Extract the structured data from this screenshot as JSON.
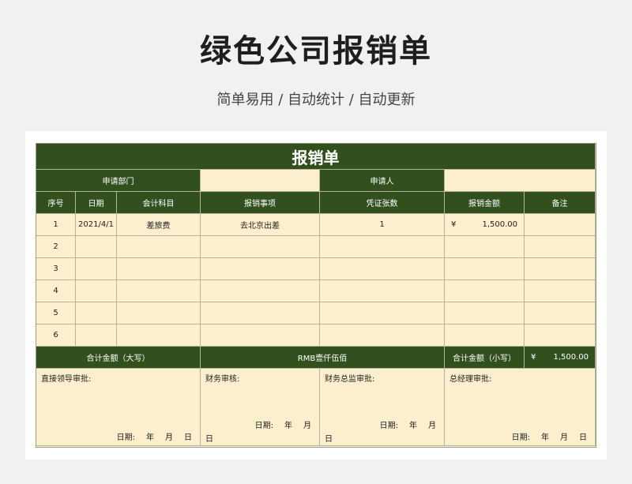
{
  "page": {
    "title": "绿色公司报销单",
    "subtitle": "简单易用  /  自动统计  /  自动更新"
  },
  "form": {
    "banner": "报销单",
    "dept_label": "申请部门",
    "dept_value": "",
    "applicant_label": "申请人",
    "applicant_value": "",
    "headers": [
      "序号",
      "日期",
      "会计科目",
      "报销事项",
      "凭证张数",
      "报销金额",
      "备注"
    ],
    "rows": [
      {
        "no": "1",
        "date": "2021/4/1",
        "subject": "差旅费",
        "item": "去北京出差",
        "vouchers": "1",
        "currency": "¥",
        "amount": "1,500.00",
        "note": ""
      },
      {
        "no": "2",
        "date": "",
        "subject": "",
        "item": "",
        "vouchers": "",
        "currency": "",
        "amount": "",
        "note": ""
      },
      {
        "no": "3",
        "date": "",
        "subject": "",
        "item": "",
        "vouchers": "",
        "currency": "",
        "amount": "",
        "note": ""
      },
      {
        "no": "4",
        "date": "",
        "subject": "",
        "item": "",
        "vouchers": "",
        "currency": "",
        "amount": "",
        "note": ""
      },
      {
        "no": "5",
        "date": "",
        "subject": "",
        "item": "",
        "vouchers": "",
        "currency": "",
        "amount": "",
        "note": ""
      },
      {
        "no": "6",
        "date": "",
        "subject": "",
        "item": "",
        "vouchers": "",
        "currency": "",
        "amount": "",
        "note": ""
      }
    ],
    "total": {
      "upper_label": "合计金额（大写）",
      "upper_value": "RMB壹仟伍佰",
      "lower_label": "合计金额（小写）",
      "currency": "¥",
      "lower_value": "1,500.00"
    },
    "signatures": [
      {
        "label": "直接领导审批:",
        "date": [
          "日期:",
          "年",
          "月",
          "日"
        ],
        "tail": ""
      },
      {
        "label": "财务审核:",
        "date": [
          "日期:",
          "年",
          "月"
        ],
        "tail": "日"
      },
      {
        "label": "财务总监审批:",
        "date": [
          "日期:",
          "年",
          "月"
        ],
        "tail": "日"
      },
      {
        "label": "总经理审批:",
        "date": [
          "日期:",
          "年",
          "月",
          "日"
        ],
        "tail": ""
      }
    ]
  }
}
